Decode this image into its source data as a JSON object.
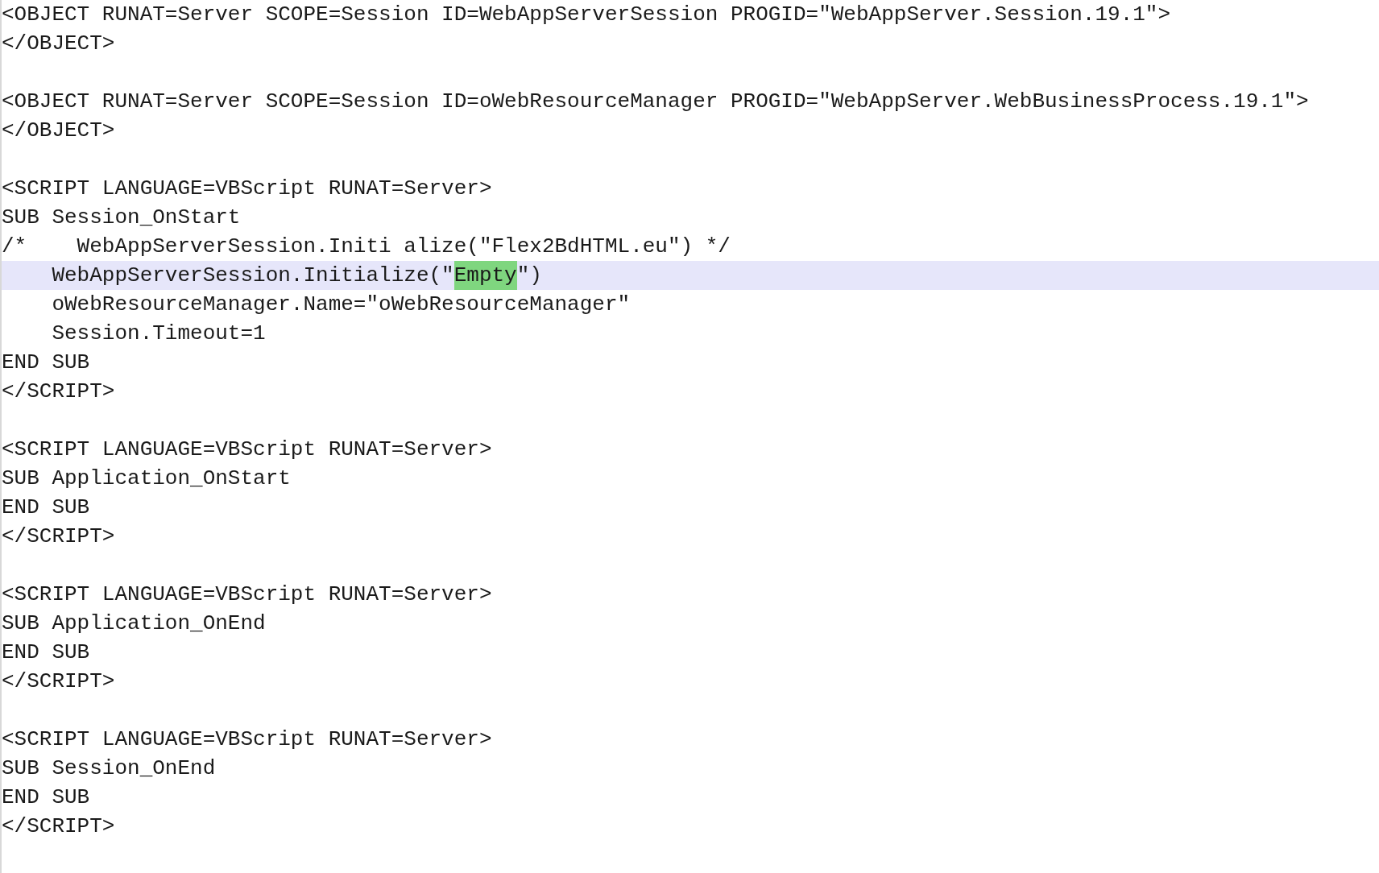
{
  "lines": [
    {
      "kind": "code",
      "current": false,
      "segments": [
        {
          "text": "<OBJECT RUNAT=Server SCOPE=Session ID=WebAppServerSession PROGID=\"WebAppServer.Session.19.1\">",
          "match": false
        }
      ]
    },
    {
      "kind": "code",
      "current": false,
      "segments": [
        {
          "text": "</OBJECT>",
          "match": false
        }
      ]
    },
    {
      "kind": "blank",
      "current": false
    },
    {
      "kind": "code",
      "current": false,
      "segments": [
        {
          "text": "<OBJECT RUNAT=Server SCOPE=Session ID=oWebResourceManager PROGID=\"WebAppServer.WebBusinessProcess.19.1\">",
          "match": false
        }
      ]
    },
    {
      "kind": "code",
      "current": false,
      "segments": [
        {
          "text": "</OBJECT>",
          "match": false
        }
      ]
    },
    {
      "kind": "blank",
      "current": false
    },
    {
      "kind": "code",
      "current": false,
      "segments": [
        {
          "text": "<SCRIPT LANGUAGE=VBScript RUNAT=Server>",
          "match": false
        }
      ]
    },
    {
      "kind": "code",
      "current": false,
      "segments": [
        {
          "text": "SUB Session_OnStart",
          "match": false
        }
      ]
    },
    {
      "kind": "code",
      "current": false,
      "segments": [
        {
          "text": "/*    WebAppServerSession.Initi alize(\"Flex2BdHTML.eu\") */",
          "match": false
        }
      ]
    },
    {
      "kind": "code",
      "current": true,
      "segments": [
        {
          "text": "    WebAppServerSession.Initialize(\"",
          "match": false
        },
        {
          "text": "Empty",
          "match": true
        },
        {
          "text": "\")",
          "match": false
        }
      ]
    },
    {
      "kind": "code",
      "current": false,
      "segments": [
        {
          "text": "    oWebResourceManager.Name=\"oWebResourceManager\"",
          "match": false
        }
      ]
    },
    {
      "kind": "code",
      "current": false,
      "segments": [
        {
          "text": "    Session.Timeout=1",
          "match": false
        }
      ]
    },
    {
      "kind": "code",
      "current": false,
      "segments": [
        {
          "text": "END SUB",
          "match": false
        }
      ]
    },
    {
      "kind": "code",
      "current": false,
      "segments": [
        {
          "text": "</SCRIPT>",
          "match": false
        }
      ]
    },
    {
      "kind": "blank",
      "current": false
    },
    {
      "kind": "code",
      "current": false,
      "segments": [
        {
          "text": "<SCRIPT LANGUAGE=VBScript RUNAT=Server>",
          "match": false
        }
      ]
    },
    {
      "kind": "code",
      "current": false,
      "segments": [
        {
          "text": "SUB Application_OnStart",
          "match": false
        }
      ]
    },
    {
      "kind": "code",
      "current": false,
      "segments": [
        {
          "text": "END SUB",
          "match": false
        }
      ]
    },
    {
      "kind": "code",
      "current": false,
      "segments": [
        {
          "text": "</SCRIPT>",
          "match": false
        }
      ]
    },
    {
      "kind": "blank",
      "current": false
    },
    {
      "kind": "code",
      "current": false,
      "segments": [
        {
          "text": "<SCRIPT LANGUAGE=VBScript RUNAT=Server>",
          "match": false
        }
      ]
    },
    {
      "kind": "code",
      "current": false,
      "segments": [
        {
          "text": "SUB Application_OnEnd",
          "match": false
        }
      ]
    },
    {
      "kind": "code",
      "current": false,
      "segments": [
        {
          "text": "END SUB",
          "match": false
        }
      ]
    },
    {
      "kind": "code",
      "current": false,
      "segments": [
        {
          "text": "</SCRIPT>",
          "match": false
        }
      ]
    },
    {
      "kind": "blank",
      "current": false
    },
    {
      "kind": "code",
      "current": false,
      "segments": [
        {
          "text": "<SCRIPT LANGUAGE=VBScript RUNAT=Server>",
          "match": false
        }
      ]
    },
    {
      "kind": "code",
      "current": false,
      "segments": [
        {
          "text": "SUB Session_OnEnd",
          "match": false
        }
      ]
    },
    {
      "kind": "code",
      "current": false,
      "segments": [
        {
          "text": "END SUB",
          "match": false
        }
      ]
    },
    {
      "kind": "code",
      "current": false,
      "segments": [
        {
          "text": "</SCRIPT>",
          "match": false
        }
      ]
    }
  ]
}
